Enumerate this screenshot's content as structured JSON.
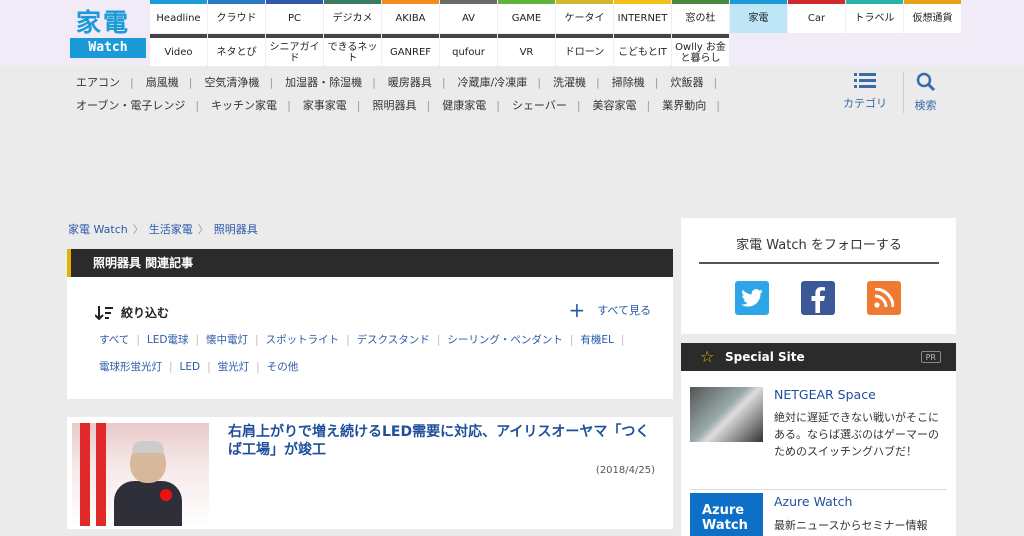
{
  "logo": {
    "kanji": "家電",
    "watch": "Watch"
  },
  "nav": {
    "row1": [
      {
        "label": "Headline",
        "color": "#1a9ad6"
      },
      {
        "label": "クラウド",
        "color": "#2a77c2"
      },
      {
        "label": "PC",
        "color": "#2e5aa8"
      },
      {
        "label": "デジカメ",
        "color": "#3b7a63"
      },
      {
        "label": "AKIBA",
        "color": "#f28c1a"
      },
      {
        "label": "AV",
        "color": "#6b6b6b"
      },
      {
        "label": "GAME",
        "color": "#63b23e"
      },
      {
        "label": "ケータイ",
        "color": "#d0b82a"
      },
      {
        "label": "INTERNET",
        "color": "#f2c21a"
      },
      {
        "label": "窓の杜",
        "color": "#4a8a3a"
      },
      {
        "label": "家電",
        "color": "#1a9ad6"
      },
      {
        "label": "Car",
        "color": "#d02a2a"
      },
      {
        "label": "トラベル",
        "color": "#2ab3a8"
      },
      {
        "label": "仮想通貨",
        "color": "#e8a21a"
      }
    ],
    "row2": [
      {
        "label": "Video",
        "color": "#444"
      },
      {
        "label": "ネタとぴ",
        "color": "#444"
      },
      {
        "label": "シニアガイド",
        "color": "#444"
      },
      {
        "label": "できるネット",
        "color": "#444"
      },
      {
        "label": "GANREF",
        "color": "#444"
      },
      {
        "label": "qufour",
        "color": "#444"
      },
      {
        "label": "VR",
        "color": "#444"
      },
      {
        "label": "ドローン",
        "color": "#444"
      },
      {
        "label": "こどもとIT",
        "color": "#444"
      },
      {
        "label": "Owlly お金と暮らし",
        "color": "#444"
      }
    ]
  },
  "categories": [
    "エアコン",
    "扇風機",
    "空気清浄機",
    "加湿器・除湿機",
    "暖房器具",
    "冷蔵庫/冷凍庫",
    "洗濯機",
    "掃除機",
    "炊飯器",
    "オーブン・電子レンジ",
    "キッチン家電",
    "家事家電",
    "照明器具",
    "健康家電",
    "シェーバー",
    "美容家電",
    "業界動向"
  ],
  "tools": {
    "category": "カテゴリ",
    "search": "検索"
  },
  "breadcrumb": [
    "家電 Watch",
    "生活家電",
    "照明器具"
  ],
  "section": {
    "heading": "照明器具 関連記事",
    "filter_title": "絞り込む",
    "see_all": "すべて見る",
    "tags": [
      "すべて",
      "LED電球",
      "懐中電灯",
      "スポットライト",
      "デスクスタンド",
      "シーリング・ペンダント",
      "有機EL",
      "電球形蛍光灯",
      "LED",
      "蛍光灯",
      "その他"
    ]
  },
  "article": {
    "title": "右肩上がりで増え続けるLED需要に対応、アイリスオーヤマ「つくば工場」が竣工",
    "date": "(2018/4/25)"
  },
  "sidebar": {
    "follow_title": "家電 Watch をフォローする",
    "special_title": "Special Site",
    "pr": "PR",
    "items": [
      {
        "title": "NETGEAR Space",
        "desc": "絶対に遅延できない戦いがそこにある。ならば選ぶのはゲーマーのためのスイッチングハブだ！"
      },
      {
        "title": "Azure Watch",
        "desc": "最新ニュースからセミナー情報",
        "thumb": "Azure Watch"
      }
    ]
  }
}
